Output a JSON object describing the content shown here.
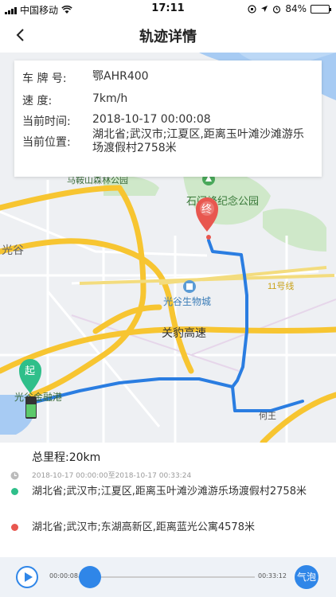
{
  "status_bar": {
    "carrier": "中国移动",
    "time": "17:11",
    "battery": "84%",
    "battery_level": 0.84
  },
  "nav": {
    "title": "轨迹详情"
  },
  "info_card": {
    "plate_label": "车 牌 号:",
    "plate_value": "鄂AHR400",
    "speed_label": "速    度:",
    "speed_value": "7km/h",
    "time_label": "当前时间:",
    "time_value": "2018-10-17 00:00:08",
    "location_label": "当前位置:",
    "location_value": "湖北省;武汉市;江夏区,距离玉叶滩沙滩游乐场渡假村2758米"
  },
  "map": {
    "labels": {
      "park_top": "马鞍山森林公园",
      "park": "石门峰纪念公园",
      "district_left": "光谷",
      "metro": "11号线",
      "bio_city": "光谷生物城",
      "highway": "关豹高速",
      "port": "光谷金融港",
      "town": "何王"
    },
    "start_marker": "起",
    "end_marker": "终",
    "colors": {
      "route": "#2a7de1",
      "start": "#2fbf8a",
      "end": "#e8574f",
      "major_road": "#f7c531"
    }
  },
  "summary": {
    "total_distance": "总里程:20km",
    "time_range": "2018-10-17 00:00:00至2018-10-17 00:33:24",
    "start_address": "湖北省;武汉市;江夏区,距离玉叶滩沙滩游乐场渡假村2758米",
    "end_address": "湖北省;武汉市;东湖高新区,距离蓝光公寓4578米"
  },
  "player": {
    "current_time": "00:00:08",
    "end_time": "00:33:12",
    "bubble_label": "气泡",
    "progress": 0.004
  }
}
